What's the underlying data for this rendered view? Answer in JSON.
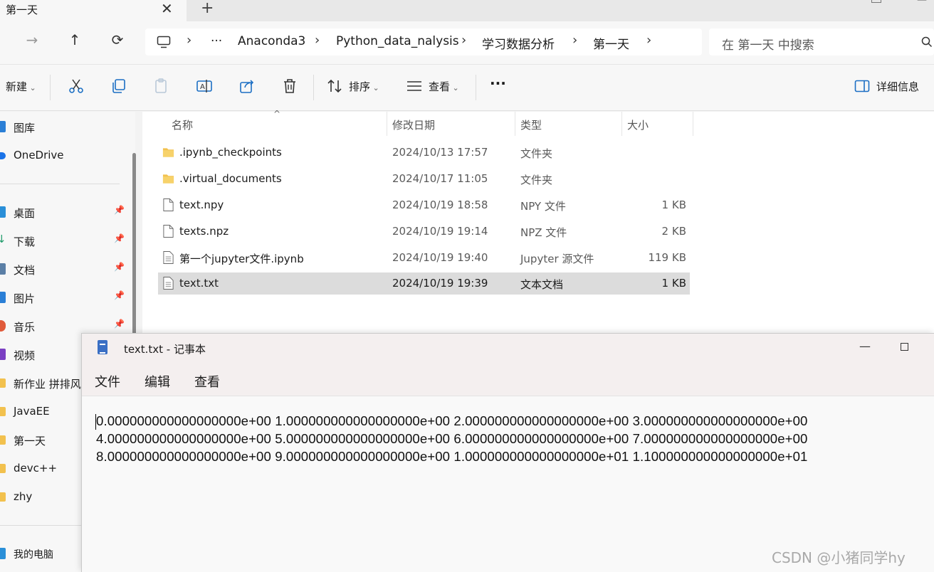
{
  "explorer": {
    "tab": {
      "title": "第一天",
      "close_glyph": "✕",
      "new_tab_glyph": "+"
    },
    "nav": {
      "back": "←",
      "forward": "→",
      "up": "↑",
      "refresh": "⟳"
    },
    "breadcrumb": {
      "overflow": "···",
      "items": [
        "Anaconda3",
        "Python_data_nalysis",
        "学习数据分析",
        "第一天"
      ]
    },
    "search": {
      "placeholder": "在 第一天 中搜索"
    },
    "toolbar": {
      "new_label": "新建",
      "sort_label": "排序",
      "view_label": "查看",
      "more_glyph": "···",
      "details_label": "详细信息"
    },
    "sidebar": {
      "items": [
        {
          "label": "图库",
          "icon": "gallery-icon",
          "color": "#2b7fd6",
          "pinned": false
        },
        {
          "label": "OneDrive",
          "icon": "cloud-icon",
          "color": "#1a73e8",
          "pinned": false
        },
        {
          "label": "桌面",
          "icon": "desktop-icon",
          "color": "#2a8fd8",
          "pinned": true
        },
        {
          "label": "下载",
          "icon": "download-icon",
          "color": "#1e9a6a",
          "pinned": true
        },
        {
          "label": "文档",
          "icon": "documents-icon",
          "color": "#5b7fa6",
          "pinned": true
        },
        {
          "label": "图片",
          "icon": "pictures-icon",
          "color": "#2b7fd6",
          "pinned": true
        },
        {
          "label": "音乐",
          "icon": "music-icon",
          "color": "#e05a3a",
          "pinned": true
        },
        {
          "label": "视频",
          "icon": "video-icon",
          "color": "#7a3fc2",
          "pinned": false
        },
        {
          "label": "新作业 拼排风",
          "icon": "folder-icon",
          "color": "#f2c14e",
          "pinned": false
        },
        {
          "label": "JavaEE",
          "icon": "folder-icon",
          "color": "#f2c14e",
          "pinned": false
        },
        {
          "label": "第一天",
          "icon": "folder-icon",
          "color": "#f2c14e",
          "pinned": false
        },
        {
          "label": "devc++",
          "icon": "folder-icon",
          "color": "#f2c14e",
          "pinned": false
        },
        {
          "label": "zhy",
          "icon": "folder-icon",
          "color": "#f2c14e",
          "pinned": false
        },
        {
          "label": "我的电脑",
          "icon": "computer-icon",
          "color": "#2a8fd8",
          "pinned": false
        }
      ],
      "pin_glyph": "📌"
    },
    "columns": {
      "name": "名称",
      "date": "修改日期",
      "type": "类型",
      "size": "大小"
    },
    "files": [
      {
        "name": ".ipynb_checkpoints",
        "date": "2024/10/13 17:57",
        "type": "文件夹",
        "size": "",
        "kind": "folder"
      },
      {
        "name": ".virtual_documents",
        "date": "2024/10/17 11:05",
        "type": "文件夹",
        "size": "",
        "kind": "folder"
      },
      {
        "name": "text.npy",
        "date": "2024/10/19 18:58",
        "type": "NPY 文件",
        "size": "1 KB",
        "kind": "file"
      },
      {
        "name": "texts.npz",
        "date": "2024/10/19 19:14",
        "type": "NPZ 文件",
        "size": "2 KB",
        "kind": "file"
      },
      {
        "name": "第一个jupyter文件.ipynb",
        "date": "2024/10/19 19:40",
        "type": "Jupyter 源文件",
        "size": "119 KB",
        "kind": "text"
      },
      {
        "name": "text.txt",
        "date": "2024/10/19 19:39",
        "type": "文本文档",
        "size": "1 KB",
        "kind": "text",
        "selected": true
      }
    ]
  },
  "notepad": {
    "title": "text.txt - 记事本",
    "min_glyph": "—",
    "menu": [
      "文件",
      "编辑",
      "查看"
    ],
    "content_lines": [
      "0.000000000000000000e+00 1.000000000000000000e+00 2.000000000000000000e+00 3.000000000000000000e+00",
      "4.000000000000000000e+00 5.000000000000000000e+00 6.000000000000000000e+00 7.000000000000000000e+00",
      "8.000000000000000000e+00 9.000000000000000000e+00 1.000000000000000000e+01 1.100000000000000000e+01"
    ]
  },
  "watermark": "CSDN @小猪同学hy"
}
